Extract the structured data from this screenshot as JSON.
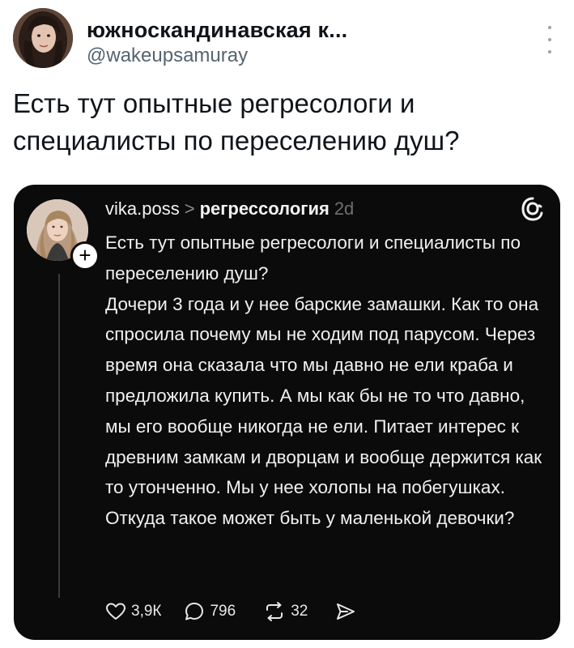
{
  "tweet": {
    "display_name": "южноскандинавская к...",
    "username": "@wakeupsamuray",
    "text": "Есть тут опытные регресологи и специалисты по переселению душ?",
    "more_icon": "more-vertical-icon"
  },
  "embed": {
    "username": "vika.poss",
    "chevron": ">",
    "topic": "регрессология",
    "time": "2d",
    "follow_symbol": "+",
    "logo_icon": "threads-logo-icon",
    "paragraphs": [
      "Есть тут опытные регресологи и специалисты по переселению душ?",
      "Дочери 3 года и у нее барские замашки. Как то она спросила почему мы не ходим под парусом. Через время она сказала что мы давно не ели краба и предложила купить. А мы как бы не то что давно, мы его вообще никогда не ели. Питает интерес к древним замкам и дворцам и вообще держится как то утонченно. Мы у нее холопы на побегушках. Откуда такое может быть  у маленькой девочки?"
    ],
    "actions": {
      "likes": "3,9К",
      "replies": "796",
      "reposts": "32"
    }
  },
  "colors": {
    "embed_bg": "#0b0b0b",
    "handle_gray": "#536471",
    "text_dark": "#0f1419"
  }
}
